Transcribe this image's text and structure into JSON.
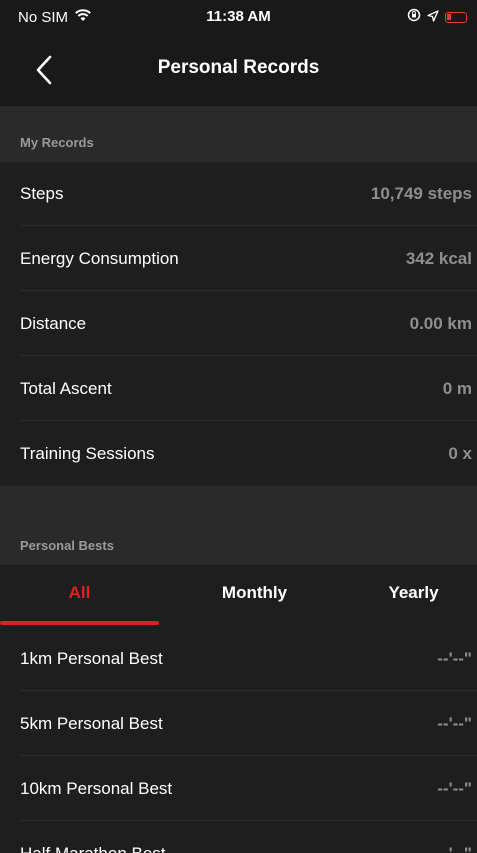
{
  "status_bar": {
    "carrier": "No SIM",
    "time": "11:38 AM"
  },
  "nav": {
    "title": "Personal Records"
  },
  "my_records": {
    "header": "My Records",
    "rows": [
      {
        "label": "Steps",
        "value": "10,749 steps"
      },
      {
        "label": "Energy Consumption",
        "value": "342 kcal"
      },
      {
        "label": "Distance",
        "value": "0.00 km"
      },
      {
        "label": "Total Ascent",
        "value": "0 m"
      },
      {
        "label": "Training Sessions",
        "value": "0 x"
      }
    ]
  },
  "personal_bests": {
    "header": "Personal Bests",
    "tabs": [
      {
        "label": "All",
        "active": true
      },
      {
        "label": "Monthly",
        "active": false
      },
      {
        "label": "Yearly",
        "active": false
      }
    ],
    "rows": [
      {
        "label": "1km Personal Best",
        "value": "--'--\""
      },
      {
        "label": "5km Personal Best",
        "value": "--'--\""
      },
      {
        "label": "10km Personal Best",
        "value": "--'--\""
      },
      {
        "label": "Half Marathon Best",
        "value": "--'--\""
      }
    ]
  },
  "colors": {
    "accent": "#e02020",
    "background": "#1e1e1e",
    "section_header": "#2a2a2a",
    "value_text": "#8e8e8e"
  }
}
